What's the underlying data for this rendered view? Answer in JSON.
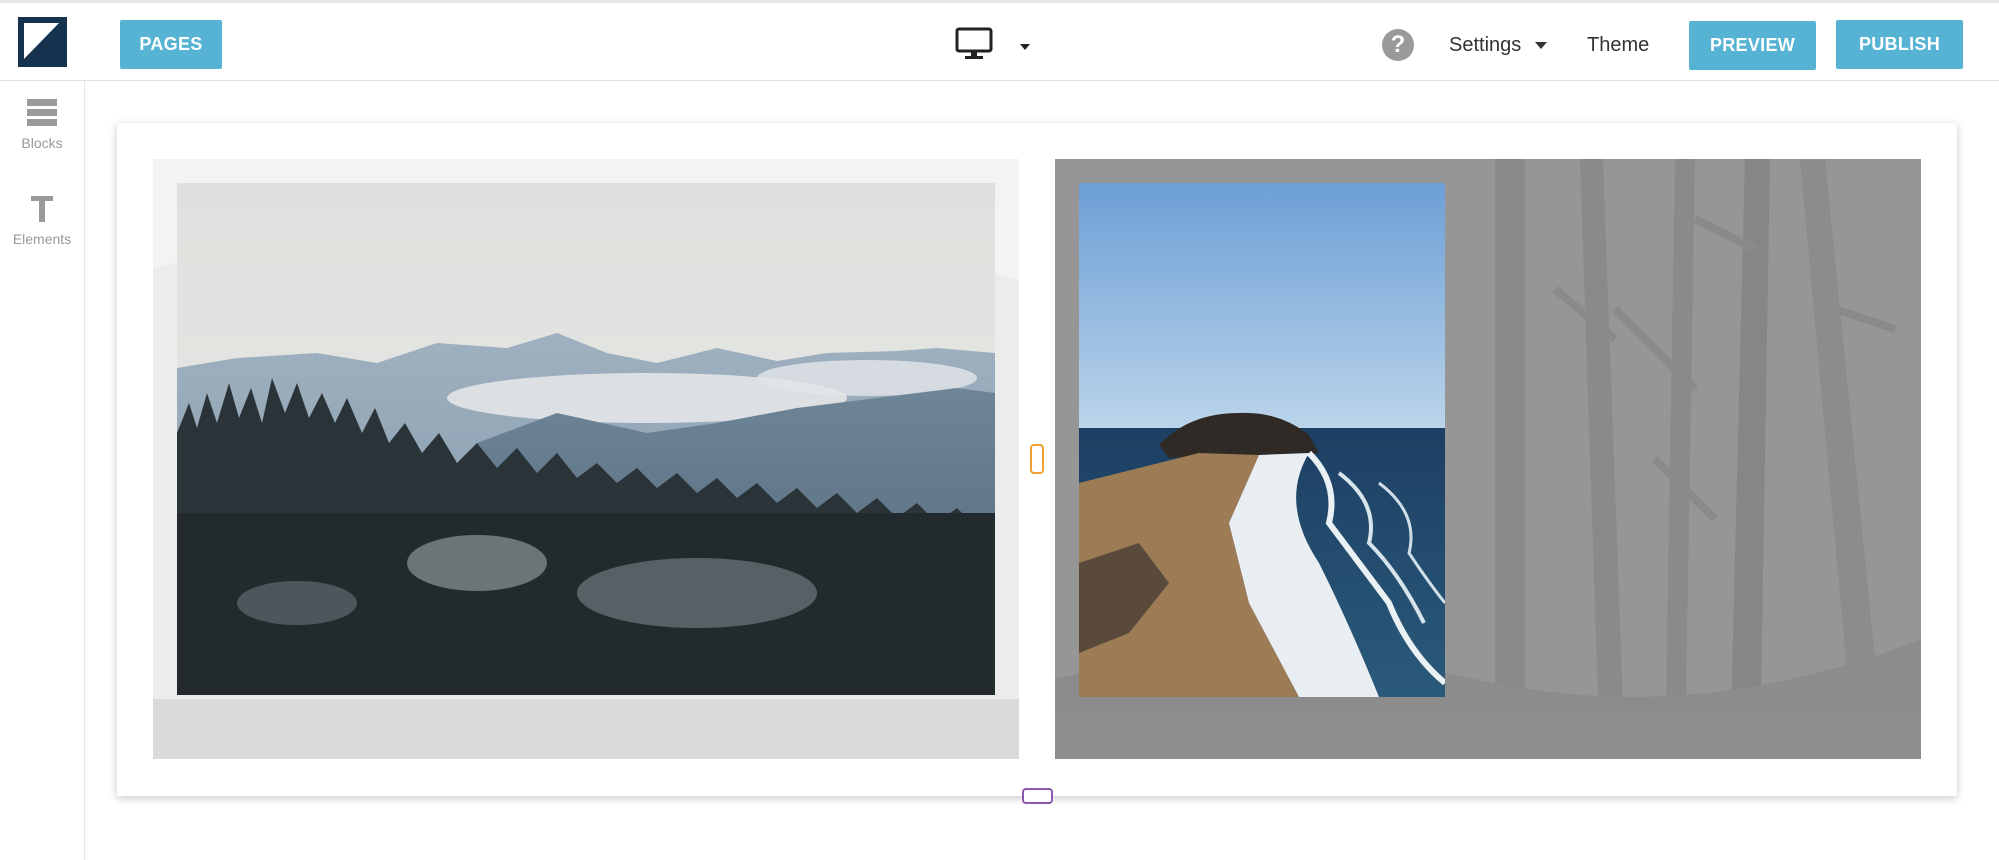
{
  "toolbar": {
    "pages_label": "PAGES",
    "preview_label": "PREVIEW",
    "publish_label": "PUBLISH",
    "help_label": "?",
    "settings_label": "Settings",
    "theme_label": "Theme",
    "device_icon": "desktop-monitor-icon",
    "accent_color": "#56b3d3",
    "logo_color": "#15334f"
  },
  "sidebar": {
    "items": [
      {
        "label": "Blocks",
        "icon": "blocks-icon"
      },
      {
        "label": "Elements",
        "icon": "text-t-icon"
      }
    ]
  },
  "content": {
    "left_image": "mountain-forest-fog-photo",
    "right_image": "coastal-beach-waves-photo",
    "left_placeholder": "forest-silhouette-background",
    "right_placeholder": "tree-trunks-background"
  }
}
